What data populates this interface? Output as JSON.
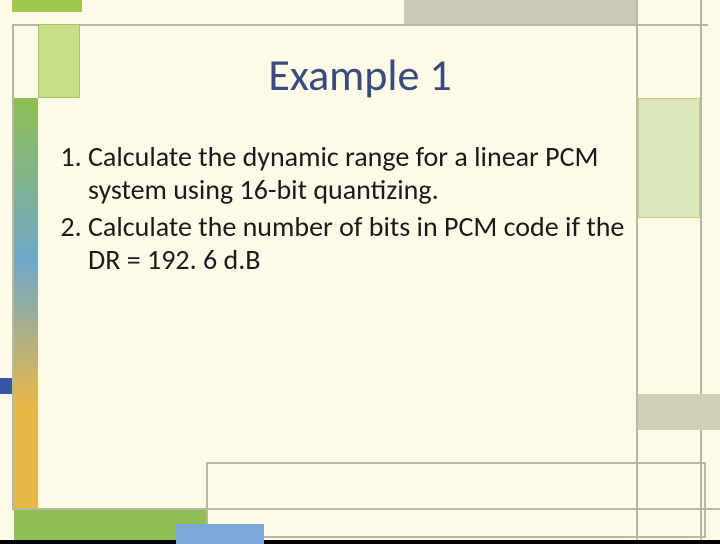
{
  "slide": {
    "title": "Example 1",
    "items": [
      "Calculate the dynamic range for a linear PCM system using 16-bit quantizing.",
      "Calculate the number of bits in PCM code if the DR = 192. 6 d.B"
    ]
  }
}
